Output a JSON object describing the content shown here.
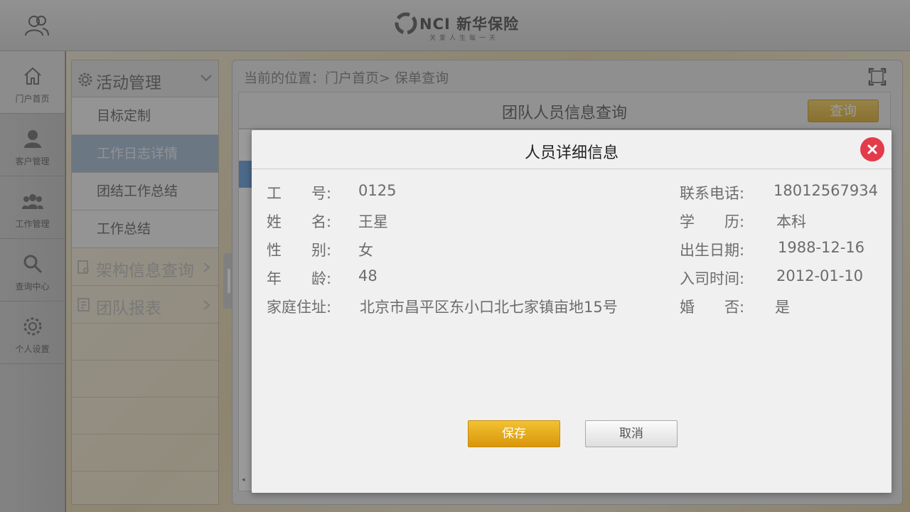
{
  "brand": {
    "logo_text": "NCI 新华保险",
    "slogan": "关爱人生每一天"
  },
  "leftnav": {
    "items": [
      {
        "label": "门户首页",
        "icon": "home-icon"
      },
      {
        "label": "客户管理",
        "icon": "customer-icon"
      },
      {
        "label": "工作管理",
        "icon": "team-icon"
      },
      {
        "label": "查询中心",
        "icon": "search-icon"
      },
      {
        "label": "个人设置",
        "icon": "gear-icon"
      }
    ]
  },
  "submenu": {
    "title": "活动管理",
    "items": [
      {
        "label": "目标定制"
      },
      {
        "label": "工作日志详情"
      },
      {
        "label": "团结工作总结"
      },
      {
        "label": "工作总结"
      }
    ],
    "groups": [
      {
        "label": "架构信息查询"
      },
      {
        "label": "团队报表"
      }
    ]
  },
  "content": {
    "breadcrumb": "当前的位置：门户首页> 保单查询",
    "query_title": "团队人员信息查询",
    "query_button": "查询"
  },
  "dialog": {
    "title": "人员详细信息",
    "left_fields": [
      {
        "label": "工　　号:",
        "value": "0125"
      },
      {
        "label": "姓　　名:",
        "value": "王星"
      },
      {
        "label": "性　　别:",
        "value": "女"
      },
      {
        "label": "年　　龄:",
        "value": "48"
      },
      {
        "label": "家庭住址:",
        "value": "北京市昌平区东小口北七家镇亩地15号"
      }
    ],
    "right_fields": [
      {
        "label": "联系电话:",
        "value": "18012567934"
      },
      {
        "label": "学　　历:",
        "value": "本科"
      },
      {
        "label": "出生日期:",
        "value": "1988-12-16"
      },
      {
        "label": "入司时间:",
        "value": "2012-01-10"
      },
      {
        "label": "婚　　否:",
        "value": "是"
      }
    ],
    "save_label": "保存",
    "cancel_label": "取消"
  },
  "colors": {
    "accent_gold": "#d9950a",
    "close_red": "#e33b4a",
    "selected_blue": "#a9bfd6"
  }
}
